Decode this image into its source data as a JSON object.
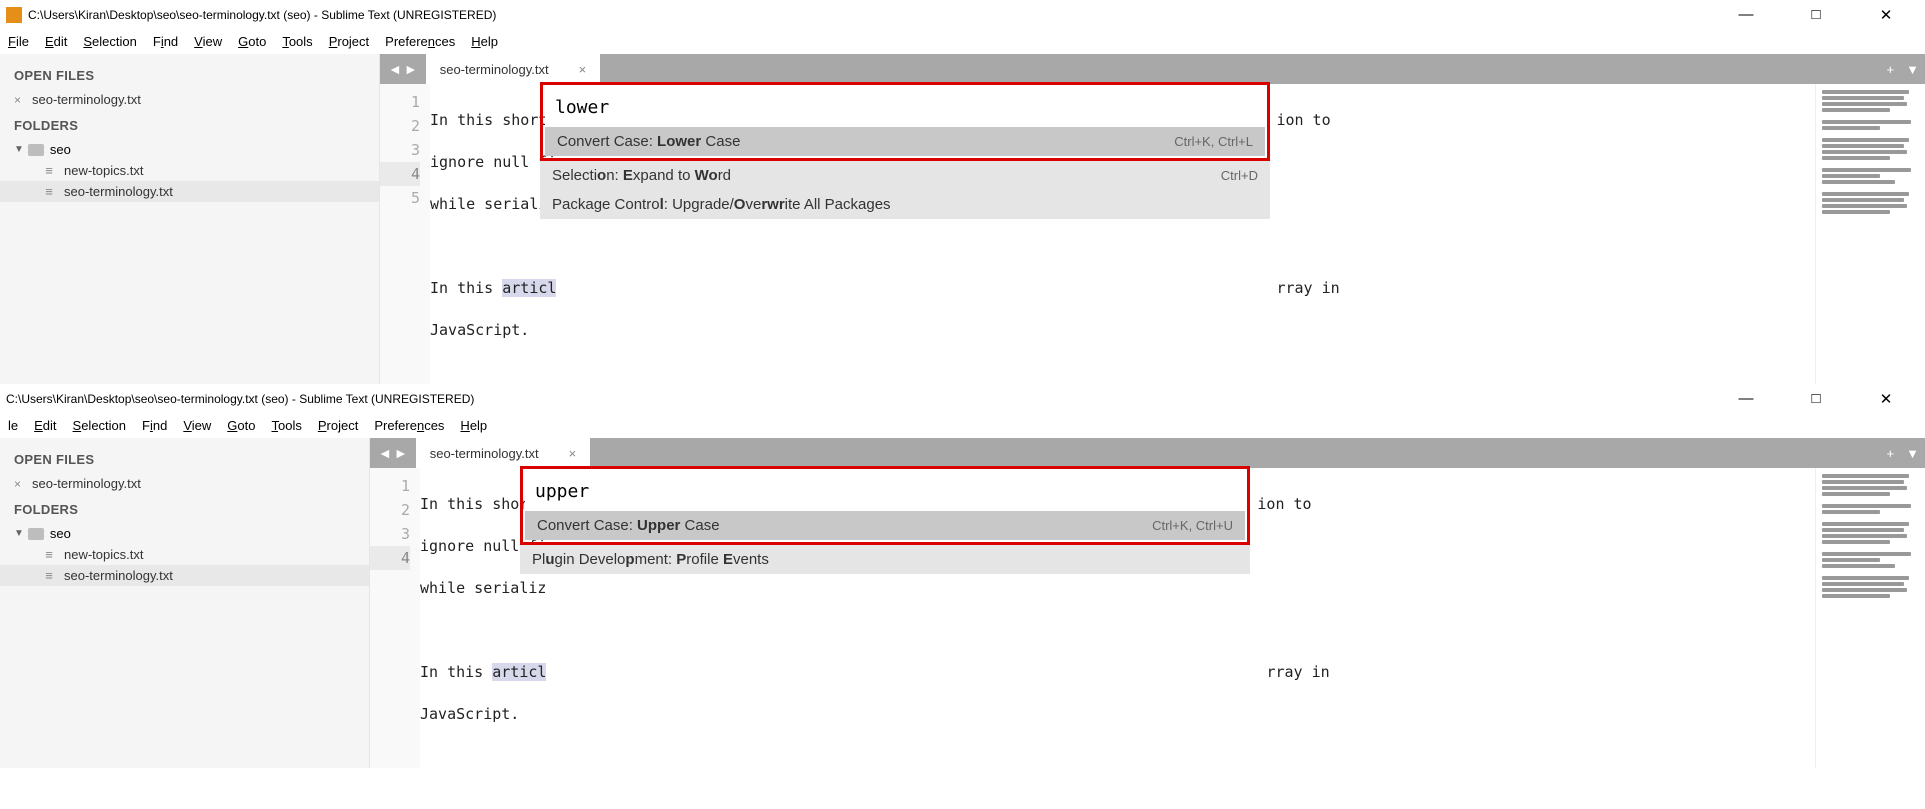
{
  "window1": {
    "title": "C:\\Users\\Kiran\\Desktop\\seo\\seo-terminology.txt (seo) - Sublime Text (UNREGISTERED)",
    "menus": [
      "File",
      "Edit",
      "Selection",
      "Find",
      "View",
      "Goto",
      "Tools",
      "Project",
      "Preferences",
      "Help"
    ],
    "open_files_label": "OPEN FILES",
    "open_files": [
      "seo-terminology.txt"
    ],
    "folders_label": "FOLDERS",
    "root_folder": "seo",
    "folder_files": [
      "new-topics.txt",
      "seo-terminology.txt"
    ],
    "tab_name": "seo-terminology.txt",
    "gutter": [
      "1",
      "2",
      "3",
      "4",
      "5"
    ],
    "code_lines": {
      "l1a": "In this short ",
      "l1b": "ion to",
      "l2a": "ignore null fi",
      "l2b": "while serializ",
      "l4a": "In this ",
      "l4art": "articl",
      "l4b": "rray in",
      "l5": "JavaScript."
    },
    "palette": {
      "input": "lower",
      "results": [
        {
          "pre": "Convert Case: ",
          "bold": "Lower",
          "post": " Case",
          "shortcut": "Ctrl+K, Ctrl+L",
          "selected": true
        },
        {
          "pre": "Selecti",
          "bold": "o",
          "mid": "n: ",
          "bold2": "E",
          "mid2": "xpand to ",
          "bold3": "Wo",
          "post": "rd",
          "shortcut": "Ctrl+D"
        },
        {
          "pre": "Package Contro",
          "bold": "l",
          "mid": ": Upgrade/",
          "bold2": "O",
          "mid2": "ve",
          "bold3": "rwr",
          "post": "ite All Packages",
          "shortcut": ""
        }
      ]
    }
  },
  "window2": {
    "title": "C:\\Users\\Kiran\\Desktop\\seo\\seo-terminology.txt (seo) - Sublime Text (UNREGISTERED)",
    "menus": [
      "le",
      "Edit",
      "Selection",
      "Find",
      "View",
      "Goto",
      "Tools",
      "Project",
      "Preferences",
      "Help"
    ],
    "open_files_label": "OPEN FILES",
    "open_files": [
      "seo-terminology.txt"
    ],
    "folders_label": "FOLDERS",
    "root_folder": "seo",
    "folder_files": [
      "new-topics.txt",
      "seo-terminology.txt"
    ],
    "tab_name": "seo-terminology.txt",
    "gutter": [
      "1",
      "2",
      "3",
      "4"
    ],
    "code_lines": {
      "l1a": "In this short",
      "l1b": "ion to",
      "l2a": "ignore null fi",
      "l2b": "while serializ",
      "l4a": "In this ",
      "l4art": "articl",
      "l4b": "rray in",
      "l5": "JavaScript."
    },
    "palette": {
      "input": "upper",
      "results": [
        {
          "pre": "Convert Case: ",
          "bold": "Upper",
          "post": " Case",
          "shortcut": "Ctrl+K, Ctrl+U",
          "selected": true
        },
        {
          "pre": "Pl",
          "bold": "u",
          "mid": "gin Develo",
          "bold2": "p",
          "mid2": "ment: ",
          "bold3": "P",
          "mid3": "rofile ",
          "bold4": "E",
          "post": "vents",
          "shortcut": ""
        }
      ]
    }
  }
}
